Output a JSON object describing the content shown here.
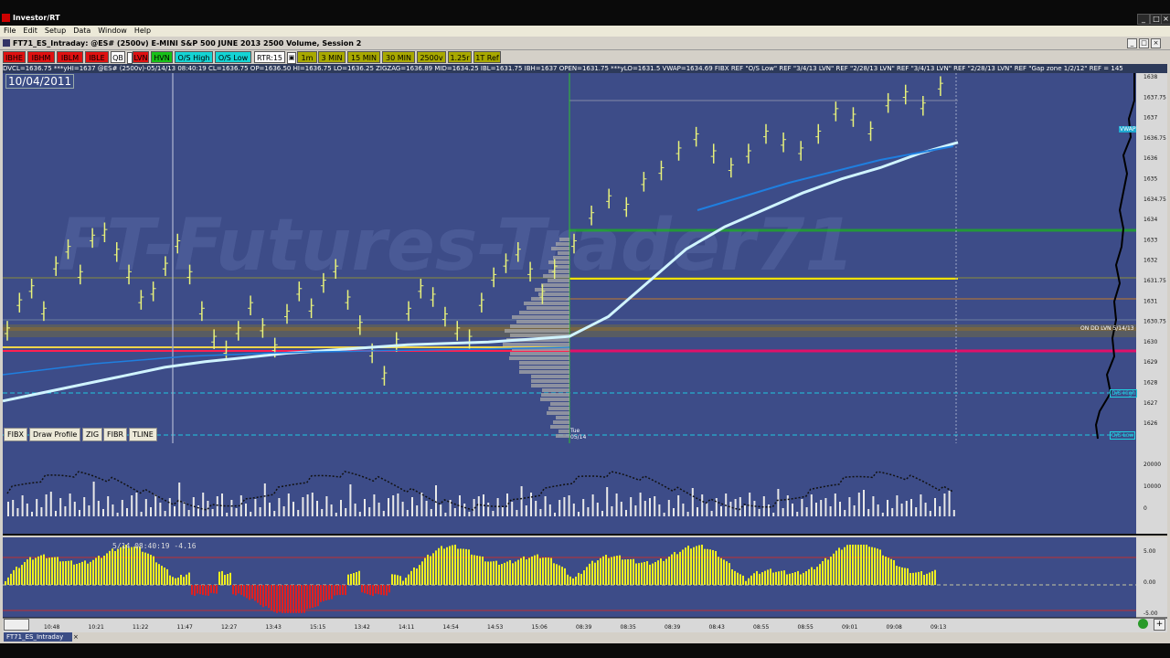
{
  "app": {
    "title": "Investor/RT"
  },
  "menu": [
    "File",
    "Edit",
    "Setup",
    "Data",
    "Window",
    "Help"
  ],
  "chart_window": {
    "title": "FT71_ES_Intraday: @ES# (2500v) E-MINI S&P 500 JUNE 2013 2500 Volume, Session 2"
  },
  "toolbar": [
    {
      "label": "IBHE",
      "bg": "#e01010",
      "fg": "#000"
    },
    {
      "label": "IBHM",
      "bg": "#e01010",
      "fg": "#000"
    },
    {
      "label": "IBLM",
      "bg": "#e01010",
      "fg": "#000"
    },
    {
      "label": "IBLE",
      "bg": "#e01010",
      "fg": "#000"
    },
    {
      "label": "QB",
      "bg": "#ffffff",
      "fg": "#000"
    },
    {
      "label": "LVN",
      "bg": "#e01010",
      "fg": "#000"
    },
    {
      "label": "HVN",
      "bg": "#18c018",
      "fg": "#000"
    },
    {
      "label": "O/S High",
      "bg": "#14d4d4",
      "fg": "#000"
    },
    {
      "label": "O/S Low",
      "bg": "#14d4d4",
      "fg": "#000"
    },
    {
      "label": "RTR:15",
      "bg": "#ffffff",
      "fg": "#000"
    },
    {
      "label": "1m",
      "bg": "#a8a800",
      "fg": "#000"
    },
    {
      "label": "3 MIN",
      "bg": "#a8a800",
      "fg": "#000"
    },
    {
      "label": "15 MIN",
      "bg": "#a8a800",
      "fg": "#000"
    },
    {
      "label": "30 MIN",
      "bg": "#a8a800",
      "fg": "#000"
    },
    {
      "label": "2500v",
      "bg": "#a8a800",
      "fg": "#000"
    },
    {
      "label": "1.25r",
      "bg": "#a8a800",
      "fg": "#000"
    },
    {
      "label": "1T Ref",
      "bg": "#a8a800",
      "fg": "#000"
    }
  ],
  "study_bar": "DVCL=1636.75 ***yHI=1637 @ES# (2500v)-05/14/13 08:40:19 CL=1636.75 OP=1636.50 HI=1636.75 LO=1636.25 ZIGZAG=1636.89 MID=1634.25 IBL=1631.75 IBH=1637 OPEN=1631.75 ***yLO=1631.5 VWAP=1634.69 FIBX REF \"O/S Low\" REF \"3/4/13 LVN\" REF \"2/28/13 LVN\" REF \"3/4/13 LVN\" REF \"2/28/13 LVN\" REF \"Gap zone 1/2/12\" REF = 145",
  "date_label": "10/04/2011",
  "watermark": "FT-Futures-Trader71",
  "draw_tools": [
    "FIBX",
    "Draw Profile",
    "ZIG",
    "FIBR",
    "TLINE"
  ],
  "price_axis": [
    "1638",
    "1637.75",
    "1637",
    "1636.75",
    "1636",
    "1635",
    "1634.75",
    "1634",
    "1633",
    "1632",
    "1631.75",
    "1631",
    "1630.75",
    "1630",
    "1629",
    "1628",
    "1627",
    "1626"
  ],
  "price_labels_right": [
    "VWAP",
    "ON DD LVN 5/14/13",
    "O/S High",
    "O/S Low"
  ],
  "volume_axis": [
    "20000",
    "10000",
    "0"
  ],
  "delta_axis": [
    "5.00",
    "0.00",
    "-5.00"
  ],
  "delta_readout": "5/14 08:40:19  -4.16",
  "time_axis": [
    "10:48",
    "10:21",
    "11:22",
    "11:47",
    "12:27",
    "13:43",
    "15:15",
    "13:42",
    "14:11",
    "14:54",
    "14:53",
    "15:06",
    "08:39",
    "08:35",
    "08:39",
    "08:43",
    "08:55",
    "08:55",
    "09:01",
    "09:08",
    "09:13"
  ],
  "day_label": "Tue\n05/14",
  "status": {
    "tab_label": "FT71_ES_Intraday"
  },
  "chart_data": {
    "type": "line",
    "title": "",
    "xlabel": "",
    "ylabel": "",
    "ylim": [
      1625.5,
      1638.5
    ],
    "series": [
      {
        "values": [
          1629.5,
          1630.5,
          1631,
          1630.2,
          1631.8,
          1632.4,
          1631.5,
          1632.8,
          1633,
          1632.3,
          1631.5,
          1630.6,
          1630.9,
          1631.8,
          1632.6,
          1631.5,
          1630.2,
          1629.2,
          1628.8,
          1629.5,
          1630.4,
          1629.6,
          1628.9,
          1630.1,
          1630.9,
          1630.3,
          1631.2,
          1631.7,
          1630.6,
          1629.7,
          1628.7,
          1627.9,
          1629.1,
          1630.2,
          1631,
          1630.7,
          1630,
          1629.5,
          1629.2,
          1630.5,
          1631.4,
          1631.9,
          1632.3,
          1631.6,
          1630.8,
          1631.7,
          1632.6,
          1633.6,
          1634.2,
          1633.9,
          1634.8,
          1635.2,
          1635.9,
          1636.4,
          1635.8,
          1635.3,
          1635.8,
          1636.5,
          1636.2,
          1635.9,
          1636.5,
          1637.3,
          1637.1,
          1636.6,
          1637.6,
          1637.9,
          1637.5,
          1638.2
        ]
      },
      {
        "values": [
          1627,
          1627.3,
          1627.6,
          1627.9,
          1628.2,
          1628.4,
          1628.55,
          1628.7,
          1628.8,
          1628.9,
          1629,
          1629.05,
          1629.1,
          1629.2,
          1629.3,
          1630,
          1631.2,
          1632.4,
          1633.2,
          1633.8,
          1634.4,
          1634.9,
          1635.3,
          1635.8,
          1636.2
        ]
      }
    ]
  }
}
